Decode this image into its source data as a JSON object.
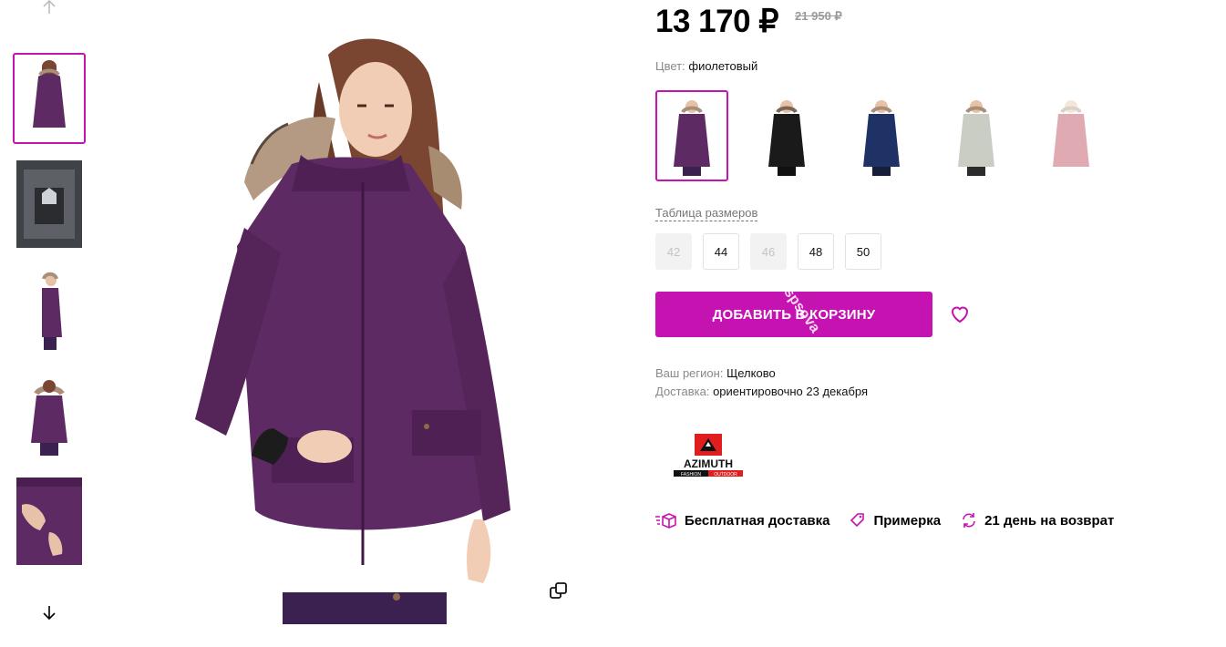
{
  "price": {
    "current": "13 170 ₽",
    "old": "21 950 ₽"
  },
  "color": {
    "label": "Цвет:",
    "value": "фиолетовый",
    "options": [
      {
        "name": "violet",
        "hex": "#5e2a63",
        "active": true
      },
      {
        "name": "black",
        "hex": "#1a1a1a",
        "active": false
      },
      {
        "name": "navy",
        "hex": "#1e3266",
        "active": false
      },
      {
        "name": "light-grey",
        "hex": "#c9cdc3",
        "active": false
      },
      {
        "name": "red",
        "hex": "#b32e44",
        "active": false,
        "faded": true
      }
    ]
  },
  "sizes": {
    "table_link": "Таблица размеров",
    "items": [
      {
        "label": "42",
        "available": false
      },
      {
        "label": "44",
        "available": true
      },
      {
        "label": "46",
        "available": false
      },
      {
        "label": "48",
        "available": true
      },
      {
        "label": "50",
        "available": true
      }
    ]
  },
  "cart": {
    "button_label": "ДОБАВИТЬ В КОРЗИНУ",
    "watermark": "spsova"
  },
  "delivery": {
    "region_label": "Ваш регион:",
    "region_value": "Щелково",
    "delivery_label": "Доставка:",
    "delivery_value": "ориентировочно 23 декабря"
  },
  "brand": {
    "name": "AZIMUTH",
    "tagline_left": "FASHION",
    "tagline_right": "OUTDOOR"
  },
  "perks": {
    "free_delivery": "Бесплатная доставка",
    "fitting": "Примерка",
    "returns": "21 день на возврат"
  },
  "colors": {
    "accent": "#c513b1",
    "jacket": "#5e2a63",
    "muted_text": "#888888"
  }
}
